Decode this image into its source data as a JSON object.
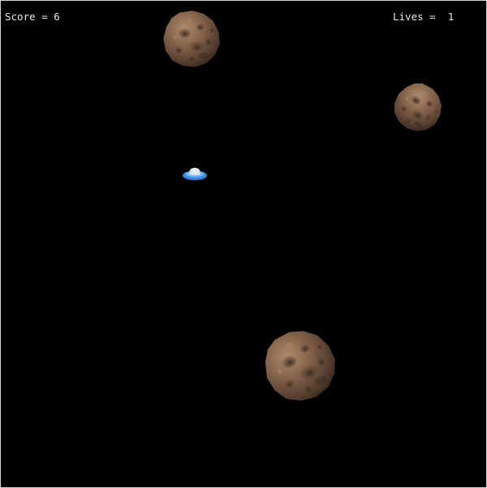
{
  "hud": {
    "score_label": "Score = ",
    "score_value": "6",
    "lives_label": "Lives =  ",
    "lives_value": "1"
  },
  "colors": {
    "background": "#000000",
    "hud_text": "#e8e8e8",
    "asteroid": "#7a5a44",
    "ship_disc": "#3f8fe6",
    "ship_dome": "#eef4ff"
  },
  "sprites": {
    "player": "flying-saucer-icon",
    "enemy": "asteroid-icon"
  }
}
